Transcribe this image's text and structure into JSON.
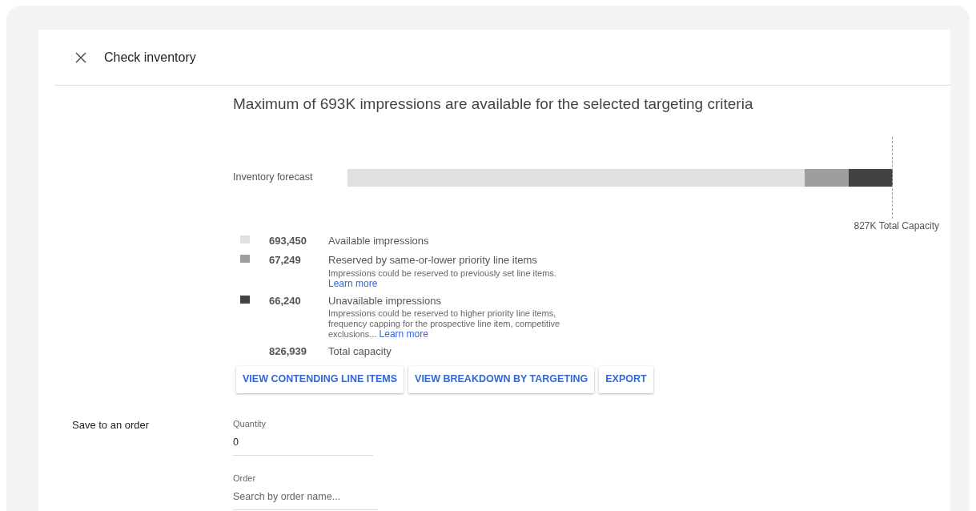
{
  "dialog": {
    "title": "Check inventory"
  },
  "headline": "Maximum of 693K impressions are available for the selected targeting criteria",
  "forecast": {
    "label": "Inventory forecast",
    "capacity_label": "827K Total Capacity"
  },
  "legend": [
    {
      "color": "#e0e0e0",
      "value": "693,450",
      "label": "Available impressions"
    },
    {
      "color": "#9e9e9e",
      "value": "67,249",
      "label": "Reserved by same-or-lower priority line items",
      "description": "Impressions could be reserved to previously set line items.",
      "link": "Learn more"
    },
    {
      "color": "#424242",
      "value": "66,240",
      "label": "Unavailable impressions",
      "description": "Impressions could be reserved to higher priority line items, frequency capping for the prospective line item, competitive exclusions...",
      "link": "Learn more"
    },
    {
      "value": "826,939",
      "label": "Total capacity"
    }
  ],
  "actions": [
    "VIEW CONTENDING LINE ITEMS",
    "VIEW BREAKDOWN BY TARGETING",
    "EXPORT"
  ],
  "save_section": {
    "title": "Save to an order",
    "fields": [
      {
        "label": "Quantity",
        "value": "0"
      },
      {
        "label": "Order",
        "placeholder": "Search by order name..."
      }
    ]
  }
}
